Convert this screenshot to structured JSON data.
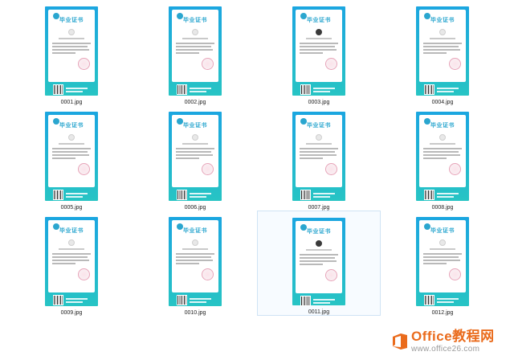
{
  "theme": {
    "card_gradient_top": "#1ba6e0",
    "card_gradient_bottom": "#27c4c4",
    "cert_title_color": "#2aa6cf",
    "selection_color": "#cfe3f5",
    "watermark_orange": "#ea6b1c",
    "watermark_gray": "#9a9a9a"
  },
  "certificate": {
    "title": "毕业证书",
    "badge_icon": "school-emblem-icon",
    "photo_icon": "avatar-icon",
    "seal_icon": "red-seal-icon",
    "qr_icon": "qr-code-icon"
  },
  "files": [
    {
      "name": "0001.jpg",
      "photo": "light",
      "selected": false
    },
    {
      "name": "0002.jpg",
      "photo": "light",
      "selected": false
    },
    {
      "name": "0003.jpg",
      "photo": "dark",
      "selected": false
    },
    {
      "name": "0004.jpg",
      "photo": "light",
      "selected": false
    },
    {
      "name": "0005.jpg",
      "photo": "light",
      "selected": false
    },
    {
      "name": "0006.jpg",
      "photo": "light",
      "selected": false
    },
    {
      "name": "0007.jpg",
      "photo": "light",
      "selected": false
    },
    {
      "name": "0008.jpg",
      "photo": "light",
      "selected": false
    },
    {
      "name": "0009.jpg",
      "photo": "light",
      "selected": false
    },
    {
      "name": "0010.jpg",
      "photo": "light",
      "selected": false
    },
    {
      "name": "0011.jpg",
      "photo": "dark",
      "selected": true
    },
    {
      "name": "0012.jpg",
      "photo": "light",
      "selected": false
    }
  ],
  "watermark": {
    "logo_icon": "office-logo-icon",
    "brand": "Office教程网",
    "url": "www.office26.com"
  }
}
